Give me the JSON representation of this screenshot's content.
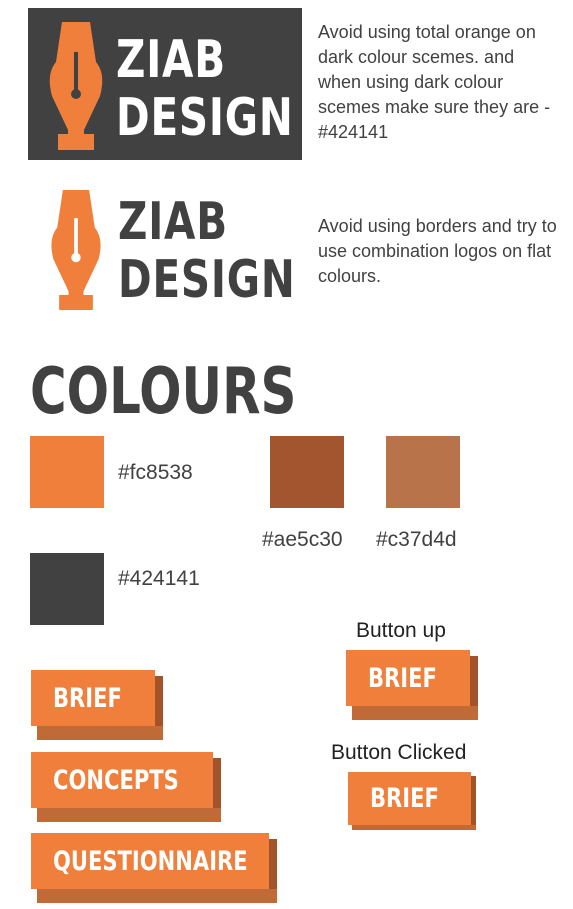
{
  "logos": {
    "line1": "ZIAB",
    "line2": "DESIGN",
    "dark_note": "Avoid using total orange on dark colour scemes. and when using dark colour scemes make sure they are - #424141",
    "light_note": "Avoid using borders and try to use combination logos on flat colours."
  },
  "colours": {
    "heading": "COLOURS",
    "swatches": [
      {
        "hex": "#fc8538",
        "color": "#f07f3b"
      },
      {
        "hex": "#ae5c30",
        "color": "#a3552f"
      },
      {
        "hex": "#c37d4d",
        "color": "#b8734a"
      },
      {
        "hex": "#424141",
        "color": "#424141"
      }
    ]
  },
  "buttons": {
    "items": [
      "BRIEF",
      "CONCEPTS",
      "QUESTIONNAIRE"
    ],
    "up_caption": "Button up",
    "up_label": "BRIEF",
    "clicked_caption": "Button Clicked",
    "clicked_label": "BRIEF"
  }
}
